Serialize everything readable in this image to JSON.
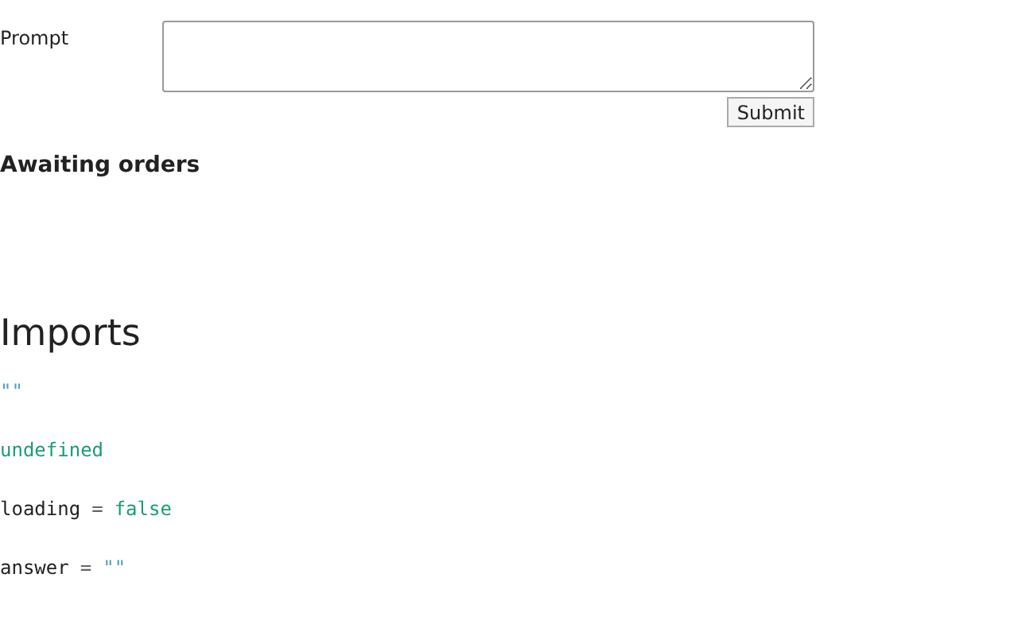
{
  "form": {
    "label": "Prompt",
    "submit": "Submit"
  },
  "status": "Awaiting orders",
  "imports": {
    "title": "Imports",
    "lines": [
      {
        "value": "\"\"",
        "kind": "string"
      },
      {
        "value": "undefined",
        "kind": "literal"
      },
      {
        "name": "loading",
        "op": "=",
        "value": "false",
        "kind": "literal"
      },
      {
        "name": "answer",
        "op": "=",
        "value": "\"\"",
        "kind": "string"
      }
    ]
  }
}
